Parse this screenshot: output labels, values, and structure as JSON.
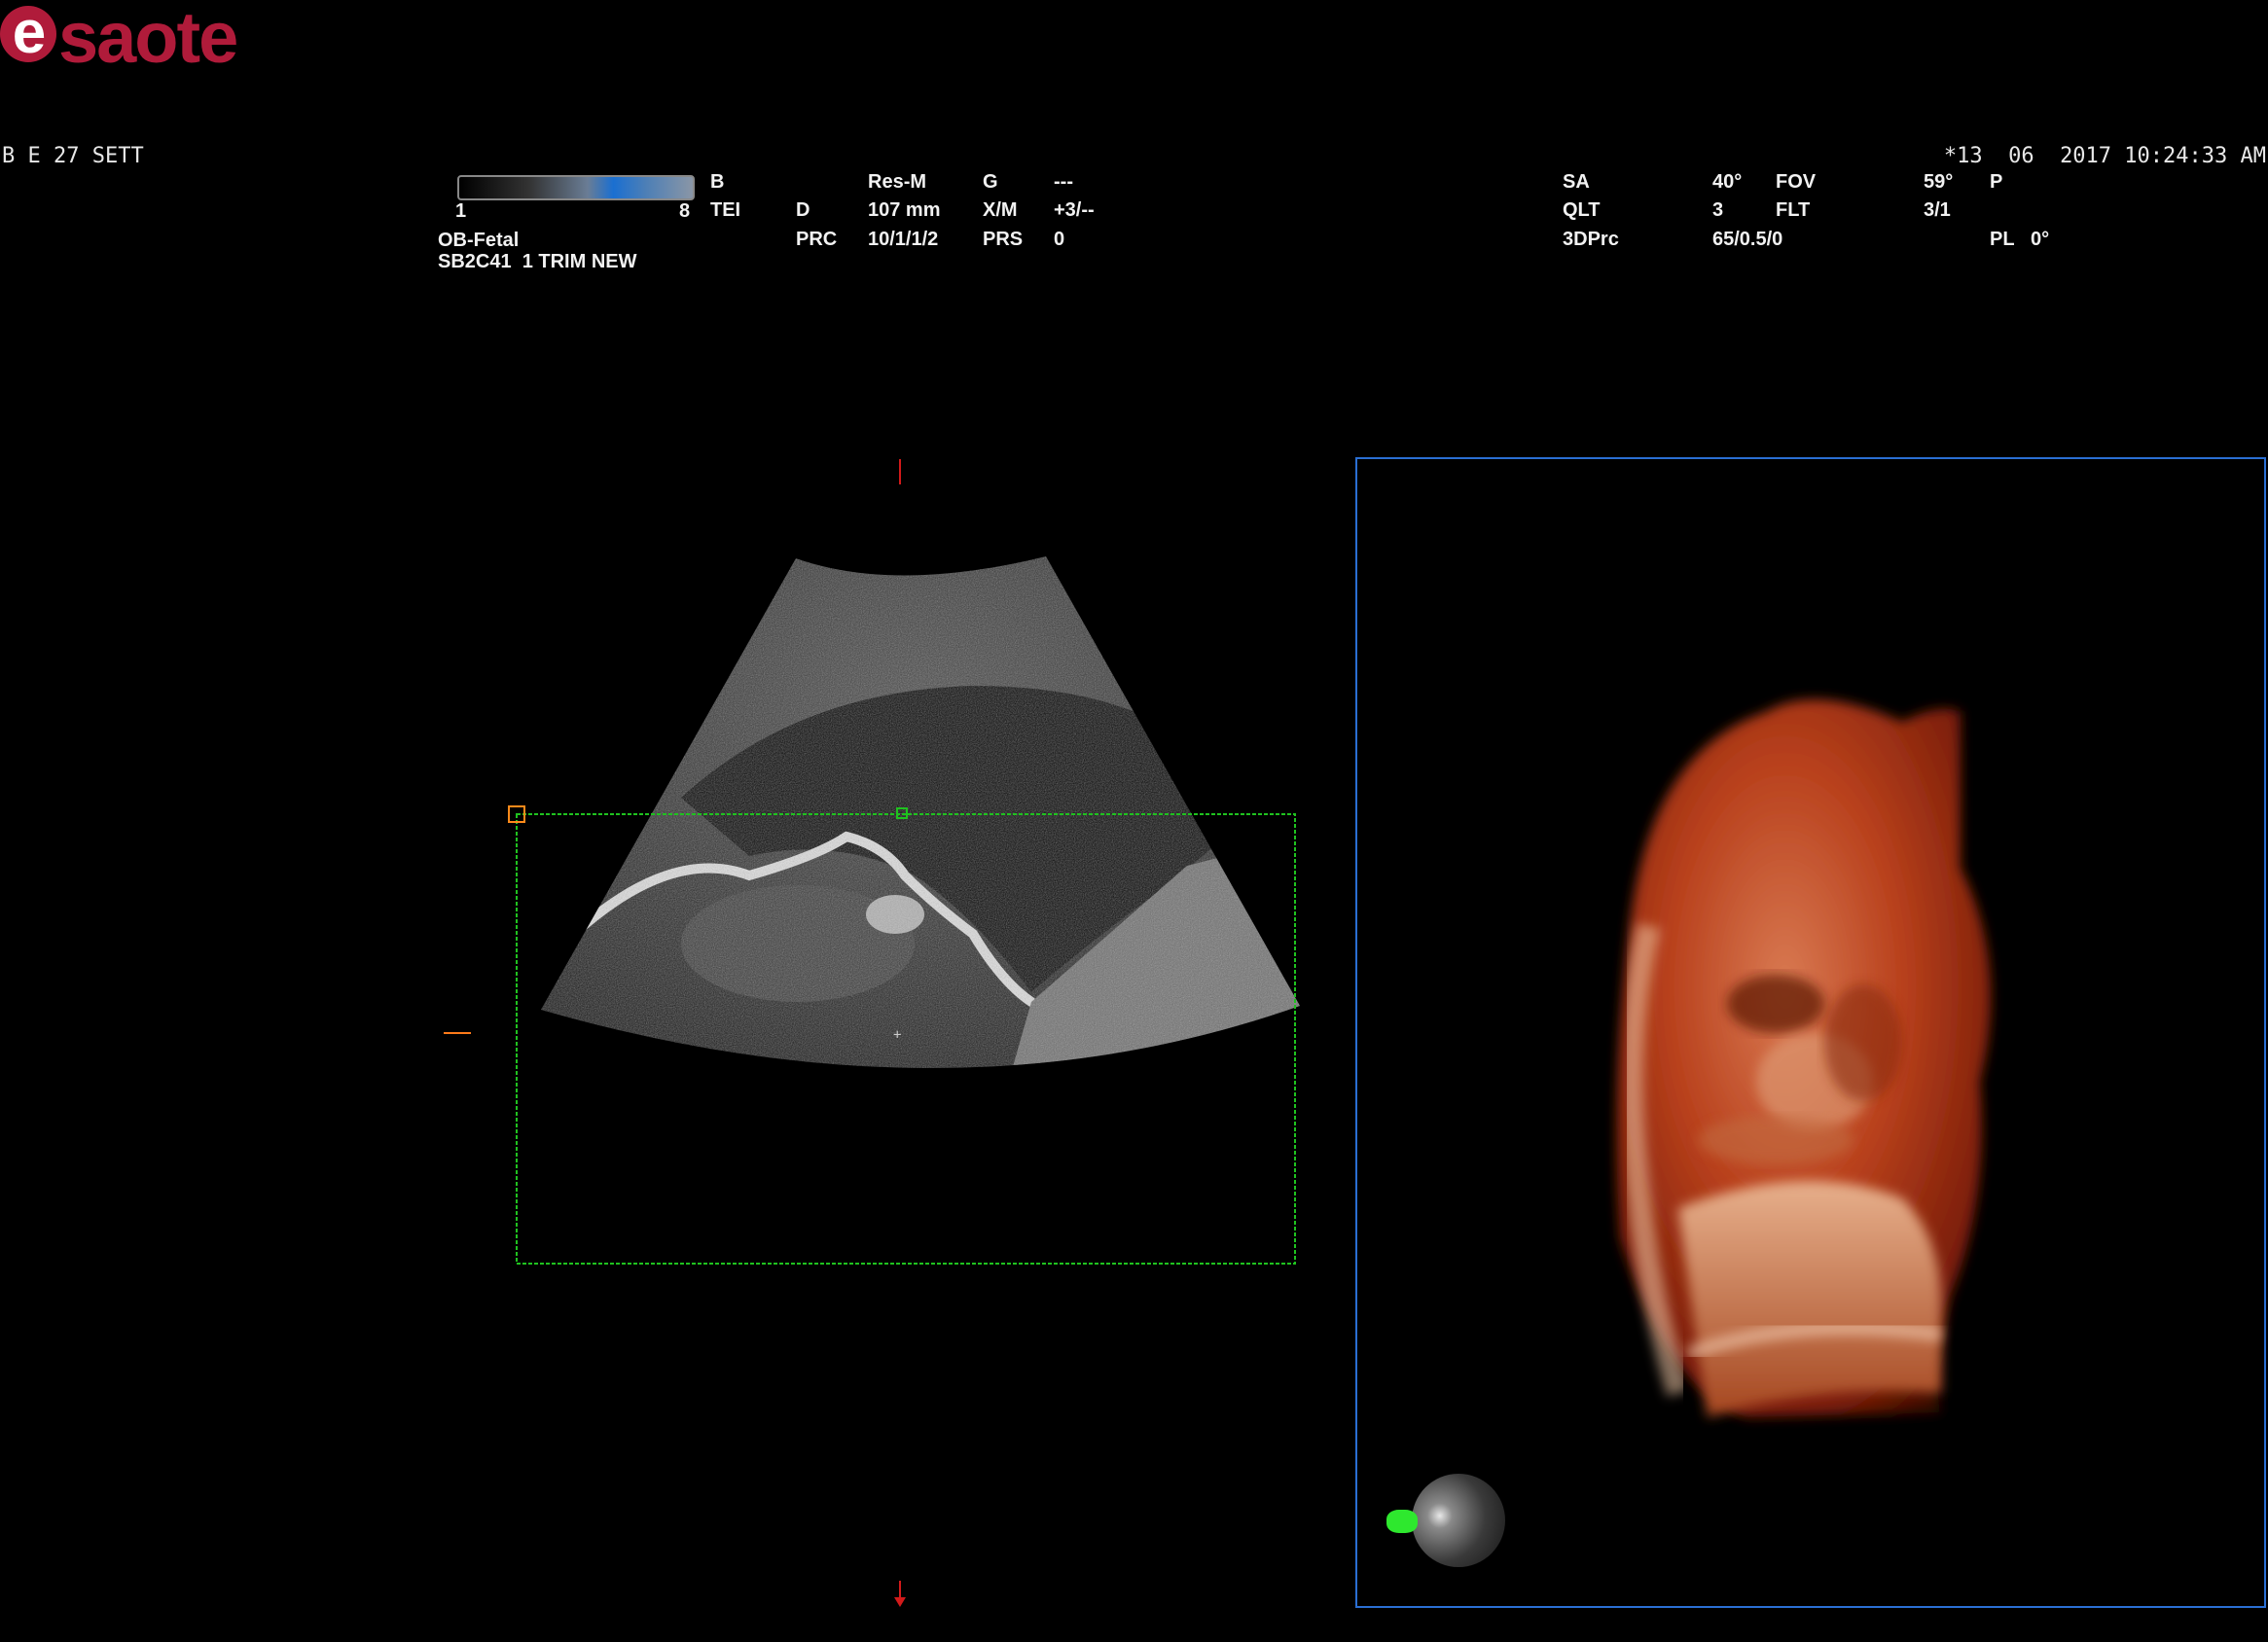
{
  "brand": {
    "logo_e": "e",
    "logo_rest": "saote"
  },
  "patient_line": "B E 27 SETT",
  "datetime": "*13  06  2017 10:24:33 AM",
  "scale": {
    "min": "1",
    "max": "8"
  },
  "preset": {
    "app": "OB-Fetal",
    "probe_line": "SB2C41  1 TRIM NEW"
  },
  "params": {
    "b": "B",
    "tei": "TEI",
    "d_label": "D",
    "prc_label": "PRC",
    "resm": "Res-M",
    "depth": "107 mm",
    "prc_value": "10/1/1/2",
    "g_label": "G",
    "xm_label": "X/M",
    "prs_label": "PRS",
    "g_value": "---",
    "xm_value": "+3/--",
    "prs_value": "0"
  },
  "params3d": {
    "sa_label": "SA",
    "qlt_label": "QLT",
    "dprc_label": "3DPrc",
    "sa_value": "40°",
    "qlt_value": "3",
    "dprc_value": "65/0.5/0",
    "fov_label": "FOV",
    "flt_label": "FLT",
    "fov_value": "59°",
    "flt_value": "3/1",
    "p_label": "P",
    "pl_label": "PL",
    "pl_value": "0°"
  },
  "colors": {
    "roi": "#1fc21f",
    "panel_border": "#2a6fd3",
    "marker_red": "#d21a1a",
    "marker_orange": "#ff7a1a",
    "render_tone": "#b8401c"
  },
  "icons": [
    "orientation-sphere-icon",
    "fetus-orientation-icon"
  ]
}
